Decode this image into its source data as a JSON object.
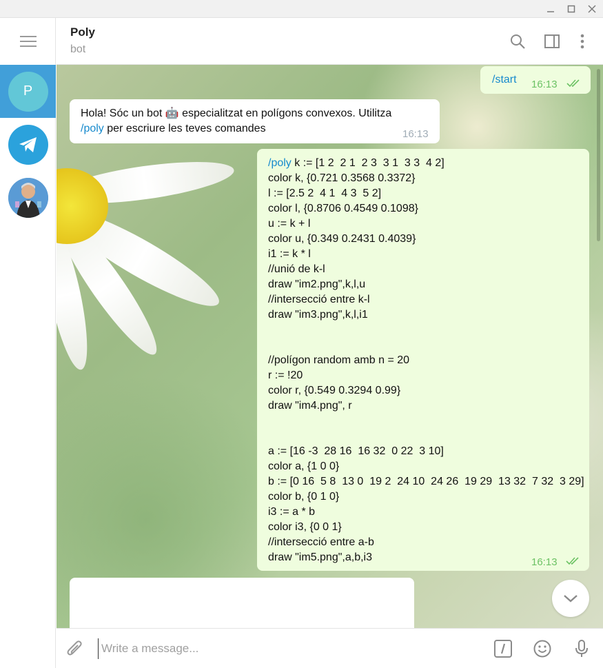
{
  "window": {
    "minimize_icon": "minimize-icon",
    "maximize_icon": "maximize-icon",
    "close_icon": "close-icon"
  },
  "sidebar": {
    "chats": [
      {
        "initial": "P",
        "color": "#62c7d7",
        "active": true
      },
      {
        "icon": "telegram-icon",
        "color": "#2ba2dc"
      },
      {
        "icon": "person-avatar",
        "color": "#4a90c8"
      }
    ],
    "active_color": "#419fd9"
  },
  "header": {
    "title": "Poly",
    "status": "bot"
  },
  "messages": {
    "start": {
      "command": "/start",
      "time": "16:13"
    },
    "greeting": {
      "line1": "Hola! Sóc un bot 🤖 especialitzat en polígons convexos. Utilitza",
      "command": "/poly",
      "line2_rest": " per escriure les teves comandes",
      "time": "16:13"
    },
    "poly": {
      "command": "/poly",
      "first_rest": " k := [1 2  2 1  2 3  3 1  3 3  4 2]",
      "lines": [
        "color k, {0.721 0.3568 0.3372}",
        "l := [2.5 2  4 1  4 3  5 2]",
        "color l, {0.8706 0.4549 0.1098}",
        "u := k + l",
        "color u, {0.349 0.2431 0.4039}",
        "i1 := k * l",
        "//unió de k-l",
        "draw \"im2.png\",k,l,u",
        "//intersecció entre k-l",
        "draw \"im3.png\",k,l,i1",
        "",
        "",
        "//polígon random amb n = 20",
        "r := !20",
        "color r, {0.549 0.3294 0.99}",
        "draw \"im4.png\", r",
        "",
        "",
        "a := [16 -3  28 16  16 32  0 22  3 10]",
        "color a, {1 0 0}",
        "b := [0 16  5 8  13 0  19 2  24 10  24 26  19 29  13 32  7 32  3 29]",
        "color b, {0 1 0}",
        "i3 := a * b",
        "color i3, {0 0 1}",
        "//intersecció entre a-b",
        "draw \"im5.png\",a,b,i3"
      ],
      "time": "16:13"
    }
  },
  "composer": {
    "placeholder": "Write a message..."
  },
  "colors": {
    "outgoing_bubble": "#effdde",
    "link": "#168acd",
    "read_ticks": "#6cc264"
  }
}
